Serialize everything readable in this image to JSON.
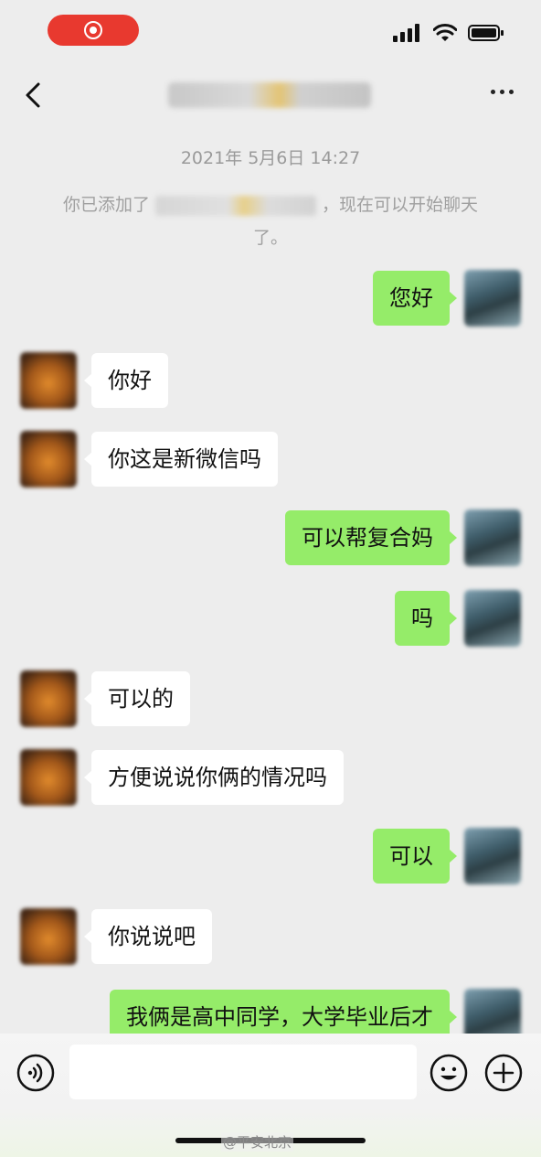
{
  "status_bar": {
    "icons": [
      "record-icon",
      "signal-icon",
      "wifi-icon",
      "battery-icon"
    ]
  },
  "header": {
    "back_icon": "chevron-left-icon",
    "more_icon": "more-dots-icon"
  },
  "chat": {
    "timestamp": "2021年 5月6日 14:27",
    "system_message": {
      "prefix": "你已添加了",
      "suffix": "，现在可以开始聊天了。"
    },
    "messages": [
      {
        "from": "me",
        "text": "您好"
      },
      {
        "from": "them",
        "text": "你好"
      },
      {
        "from": "them",
        "text": "你这是新微信吗"
      },
      {
        "from": "me",
        "text": "可以帮复合妈"
      },
      {
        "from": "me",
        "text": "吗"
      },
      {
        "from": "them",
        "text": "可以的"
      },
      {
        "from": "them",
        "text": "方便说说你俩的情况吗"
      },
      {
        "from": "me",
        "text": "可以"
      },
      {
        "from": "them",
        "text": "你说说吧"
      },
      {
        "from": "me",
        "text": "我俩是高中同学，大学毕业后才"
      }
    ]
  },
  "input_bar": {
    "voice_icon": "voice-icon",
    "emoji_icon": "emoji-icon",
    "plus_icon": "plus-icon",
    "text_value": ""
  },
  "watermark": "@平安北京",
  "colors": {
    "my_bubble": "#95ec69",
    "their_bubble": "#ffffff",
    "background": "#ededed",
    "record_pill": "#e8392f"
  }
}
